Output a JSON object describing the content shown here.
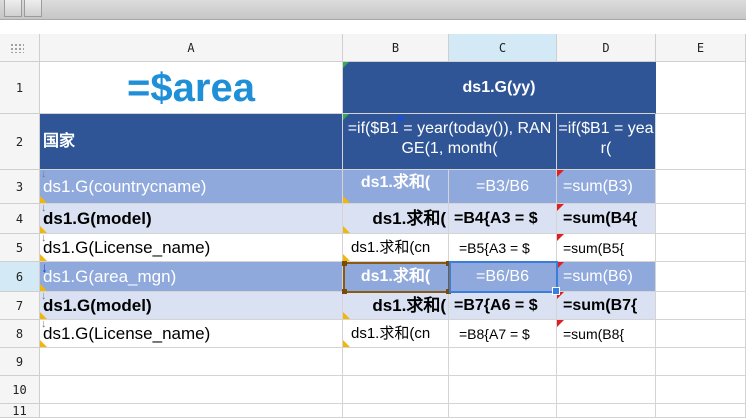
{
  "columns": [
    "A",
    "B",
    "C",
    "D",
    "E"
  ],
  "rows": [
    "1",
    "2",
    "3",
    "4",
    "5",
    "6",
    "7",
    "8",
    "9",
    "10",
    "11"
  ],
  "selected_column": "C",
  "cells": {
    "A1": "=$area",
    "B1": "ds1.G(yy)",
    "A2": "国家",
    "B2": "=if($B1 = year(today()), RANGE(1, month(",
    "D2": "=if($B1 = year(",
    "A3": "ds1.G(countrycname)",
    "B3": "ds1.求和(",
    "C3": "=B3/B6",
    "D3": "=sum(B3)",
    "A4": "ds1.G(model)",
    "B4": "ds1.求和(",
    "C4": "=B4{A3 = $",
    "D4": "=sum(B4{",
    "A5": "ds1.G(License_name)",
    "B5": "ds1.求和(cn",
    "C5": "=B5{A3 = $",
    "D5": "=sum(B5{",
    "A6": "ds1.G(area_mgn)",
    "B6": "ds1.求和(",
    "C6": "=B6/B6",
    "D6": "=sum(B6)",
    "A7": "ds1.G(model)",
    "B7": "ds1.求和(",
    "C7": "=B7{A6 = $",
    "D7": "=sum(B7{",
    "A8": "ds1.G(License_name)",
    "B8": "ds1.求和(cn",
    "C8": "=B8{A7 = $",
    "D8": "=sum(B8{"
  },
  "colors": {
    "dark_band": "#2f5597",
    "mid_band": "#8fa9dc",
    "light_band": "#d9e1f2",
    "title_text": "#1f8fd8",
    "selection": "#3b7ddd",
    "expand_marker": "#f2b705",
    "formula_marker": "#e02020"
  }
}
